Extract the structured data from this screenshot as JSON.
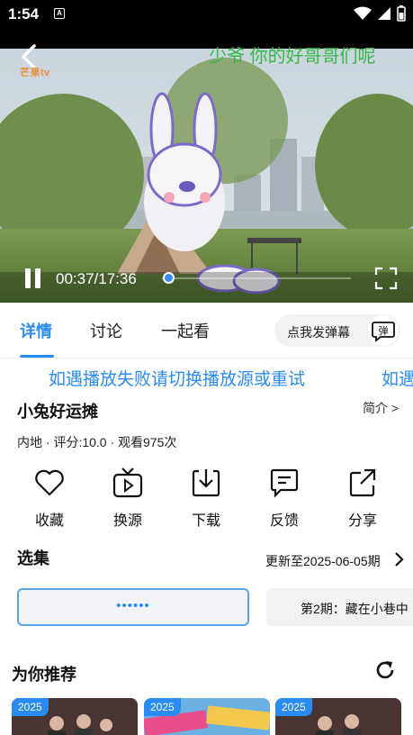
{
  "status_bar": {
    "time": "1:54",
    "notification_letter": "A"
  },
  "player": {
    "danmaku_text": "少爷 你的好哥哥们呢",
    "logo_text": "芒果tv",
    "time_display": "00:37/17:36",
    "progress_fraction": 0.035
  },
  "tabs": [
    {
      "label": "详情"
    },
    {
      "label": "讨论"
    },
    {
      "label": "一起看"
    }
  ],
  "danmaku_send": {
    "label": "点我发弹幕",
    "toggle_icon": "弹"
  },
  "notice": {
    "text": "如遇播放失败请切换播放源或重试",
    "text_repeat": "如遇"
  },
  "show": {
    "title": "小兔好运摊",
    "intro_link": "简介 >",
    "meta": "内地 · 评分:10.0 · 观看975次"
  },
  "actions": [
    {
      "label": "收藏",
      "icon": "heart-icon"
    },
    {
      "label": "换源",
      "icon": "tv-source-icon"
    },
    {
      "label": "下载",
      "icon": "download-icon"
    },
    {
      "label": "反馈",
      "icon": "feedback-icon"
    },
    {
      "label": "分享",
      "icon": "share-icon"
    }
  ],
  "episodes": {
    "title": "选集",
    "update_text": "更新至2025-06-05期",
    "items": [
      {
        "label": "••••••"
      },
      {
        "label": "第2期：藏在小巷中"
      }
    ]
  },
  "recommend": {
    "title": "为你推荐",
    "cards": [
      {
        "year": "2025"
      },
      {
        "year": "2025"
      },
      {
        "year": "2025"
      }
    ]
  },
  "colors": {
    "accent": "#2a8cf0",
    "danmaku_green": "#35b84a"
  }
}
